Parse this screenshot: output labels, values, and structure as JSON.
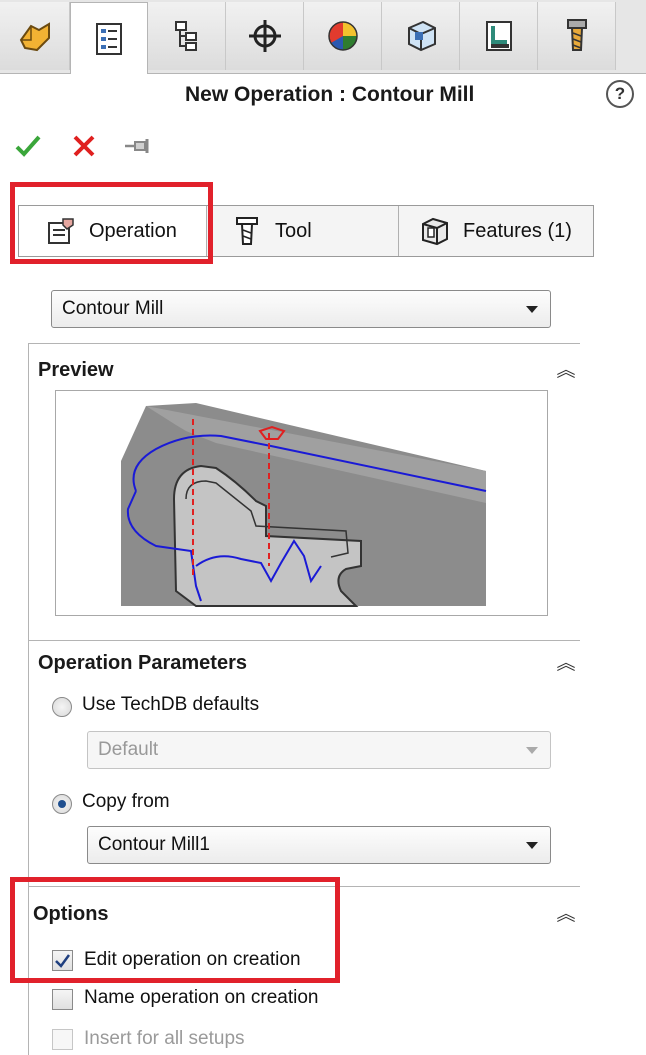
{
  "header": {
    "title": "New Operation : Contour Mill",
    "help_icon": "help-icon"
  },
  "top_tabs": [
    {
      "icon": "feature-manager-icon"
    },
    {
      "icon": "property-manager-icon",
      "active": true
    },
    {
      "icon": "configuration-manager-icon"
    },
    {
      "icon": "dimxpert-icon"
    },
    {
      "icon": "display-manager-icon"
    },
    {
      "icon": "cam-feature-tree-icon"
    },
    {
      "icon": "cam-operation-tree-icon"
    },
    {
      "icon": "cam-tool-tree-icon"
    }
  ],
  "actions": {
    "ok_icon": "checkmark-icon",
    "cancel_icon": "close-icon",
    "pin_icon": "pushpin-icon",
    "ok_color": "#3aa63a",
    "cancel_color": "#e0201f"
  },
  "panel_tabs": {
    "operation": "Operation",
    "tool": "Tool",
    "features": "Features (1)"
  },
  "operation_type": {
    "value": "Contour Mill"
  },
  "preview": {
    "title": "Preview"
  },
  "operation_parameters": {
    "title": "Operation Parameters",
    "use_techdb_label": "Use TechDB defaults",
    "use_techdb_selected": false,
    "techdb_value": "Default",
    "copy_from_label": "Copy from",
    "copy_from_selected": true,
    "copy_from_value": "Contour Mill1"
  },
  "options": {
    "title": "Options",
    "edit_on_creation_label": "Edit operation on creation",
    "edit_on_creation_checked": true,
    "name_on_creation_label": "Name operation on creation",
    "name_on_creation_checked": false,
    "insert_all_setups_label": "Insert for all setups",
    "insert_all_setups_checked": false,
    "insert_all_setups_enabled": false
  },
  "highlight_color": "#e1212b"
}
